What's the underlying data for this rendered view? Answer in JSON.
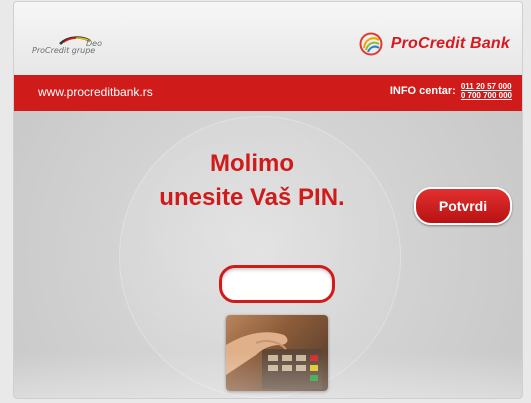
{
  "header": {
    "partner_label": "Deo",
    "partner_sub": "ProCredit grupe",
    "brand_name": "ProCredit Bank"
  },
  "bar": {
    "url": "www.procreditbank.rs",
    "info_label": "INFO centar:",
    "phones": [
      "011 20 57 000",
      "0 700 700 000"
    ]
  },
  "main": {
    "title_line1": "Molimo",
    "title_line2": "unesite Vaš PIN.",
    "confirm_label": "Potvrdi",
    "pin_value": ""
  },
  "colors": {
    "accent": "#d01b1b",
    "background": "#d6d6d6"
  }
}
